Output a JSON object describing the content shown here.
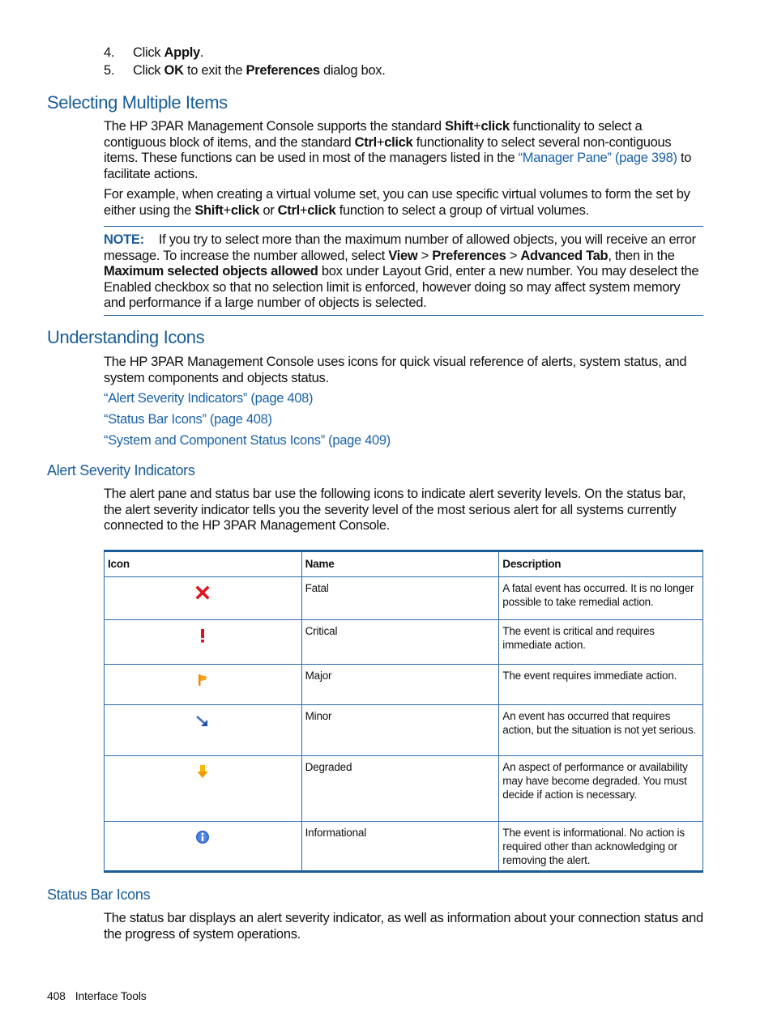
{
  "steps": [
    {
      "num": "4.",
      "pre": "Click ",
      "bold": "Apply",
      "post": "."
    },
    {
      "num": "5.",
      "pre": "Click ",
      "bold": "OK",
      "mid": " to exit the ",
      "bold2": "Preferences",
      "post": " dialog box."
    }
  ],
  "section1": {
    "heading": "Selecting Multiple Items",
    "para1": {
      "t1": "The HP 3PAR Management Console supports the standard ",
      "shift": "Shift",
      "plus1": "+",
      "click1": "click",
      "t2": " functionality to select a contiguous block of items, and the standard ",
      "ctrl": "Ctrl",
      "plus2": "+",
      "click2": "click",
      "t3": " functionality to select several non-contiguous items. These functions can be used in most of the managers listed in the ",
      "link": "“Manager Pane” (page 398)",
      "t4": " to facilitate actions."
    },
    "para2": {
      "t1": "For example, when creating a virtual volume set, you can use specific virtual volumes to form the set by either using the ",
      "shift": "Shift",
      "plus1": "+",
      "click1": "click",
      "t2": " or ",
      "ctrl": "Ctrl",
      "plus2": "+",
      "click2": "click",
      "t3": " function to select a group of virtual volumes."
    },
    "note": {
      "label": "NOTE:",
      "t1": "If you try to select more than the maximum number of allowed objects, you will receive an error message. To increase the number allowed, select ",
      "view": "View",
      "gt1": " > ",
      "prefs": "Preferences",
      "gt2": " > ",
      "adv": "Advanced Tab",
      "t2": ", then in the ",
      "max": "Maximum selected objects allowed",
      "t3": " box under Layout Grid, enter a new number. You may deselect the Enabled checkbox so that no selection limit is enforced, however doing so may affect system memory and performance if a large number of objects is selected."
    }
  },
  "section2": {
    "heading": "Understanding Icons",
    "para": "The HP 3PAR Management Console uses icons for quick visual reference of alerts, system status, and system components and objects status.",
    "links": [
      "“Alert Severity Indicators” (page 408)",
      "“Status Bar Icons” (page 408)",
      "“System and Component Status Icons” (page 409)"
    ]
  },
  "subsection1": {
    "heading": "Alert Severity Indicators",
    "para": "The alert pane and status bar use the following icons to indicate alert severity levels. On the status bar, the alert severity indicator tells you the severity level of the most serious alert for all systems currently connected to the HP 3PAR Management Console.",
    "table": {
      "headers": [
        "Icon",
        "Name",
        "Description"
      ],
      "rows": [
        {
          "icon": "fatal-x-icon",
          "name": "Fatal",
          "desc": "A fatal event has occurred. It is no longer possible to take remedial action."
        },
        {
          "icon": "critical-exclamation-icon",
          "name": "Critical",
          "desc": "The event is critical and requires immediate action."
        },
        {
          "icon": "major-flag-icon",
          "name": "Major",
          "desc": "The event requires immediate action."
        },
        {
          "icon": "minor-arrow-icon",
          "name": "Minor",
          "desc": "An event has occurred that requires action, but the situation is not yet serious."
        },
        {
          "icon": "degraded-down-arrow-icon",
          "name": "Degraded",
          "desc": "An aspect of performance or availability may have become degraded. You must decide if action is necessary."
        },
        {
          "icon": "informational-info-icon",
          "name": "Informational",
          "desc": "The event is informational. No action is required other than acknowledging or removing the alert."
        }
      ]
    }
  },
  "subsection2": {
    "heading": "Status Bar Icons",
    "para": "The status bar displays an alert severity indicator, as well as information about your connection status and the progress of system operations."
  },
  "footer": {
    "page_number": "408",
    "chapter": "Interface Tools"
  },
  "colors": {
    "heading": "#1a5c97",
    "link": "#1b62a8",
    "fatal": "#e0141e",
    "critical": "#e0141e",
    "major": "#f58a0a",
    "minor": "#1f4fa8",
    "degraded": "#f5b800",
    "info": "#2a5fc4"
  }
}
